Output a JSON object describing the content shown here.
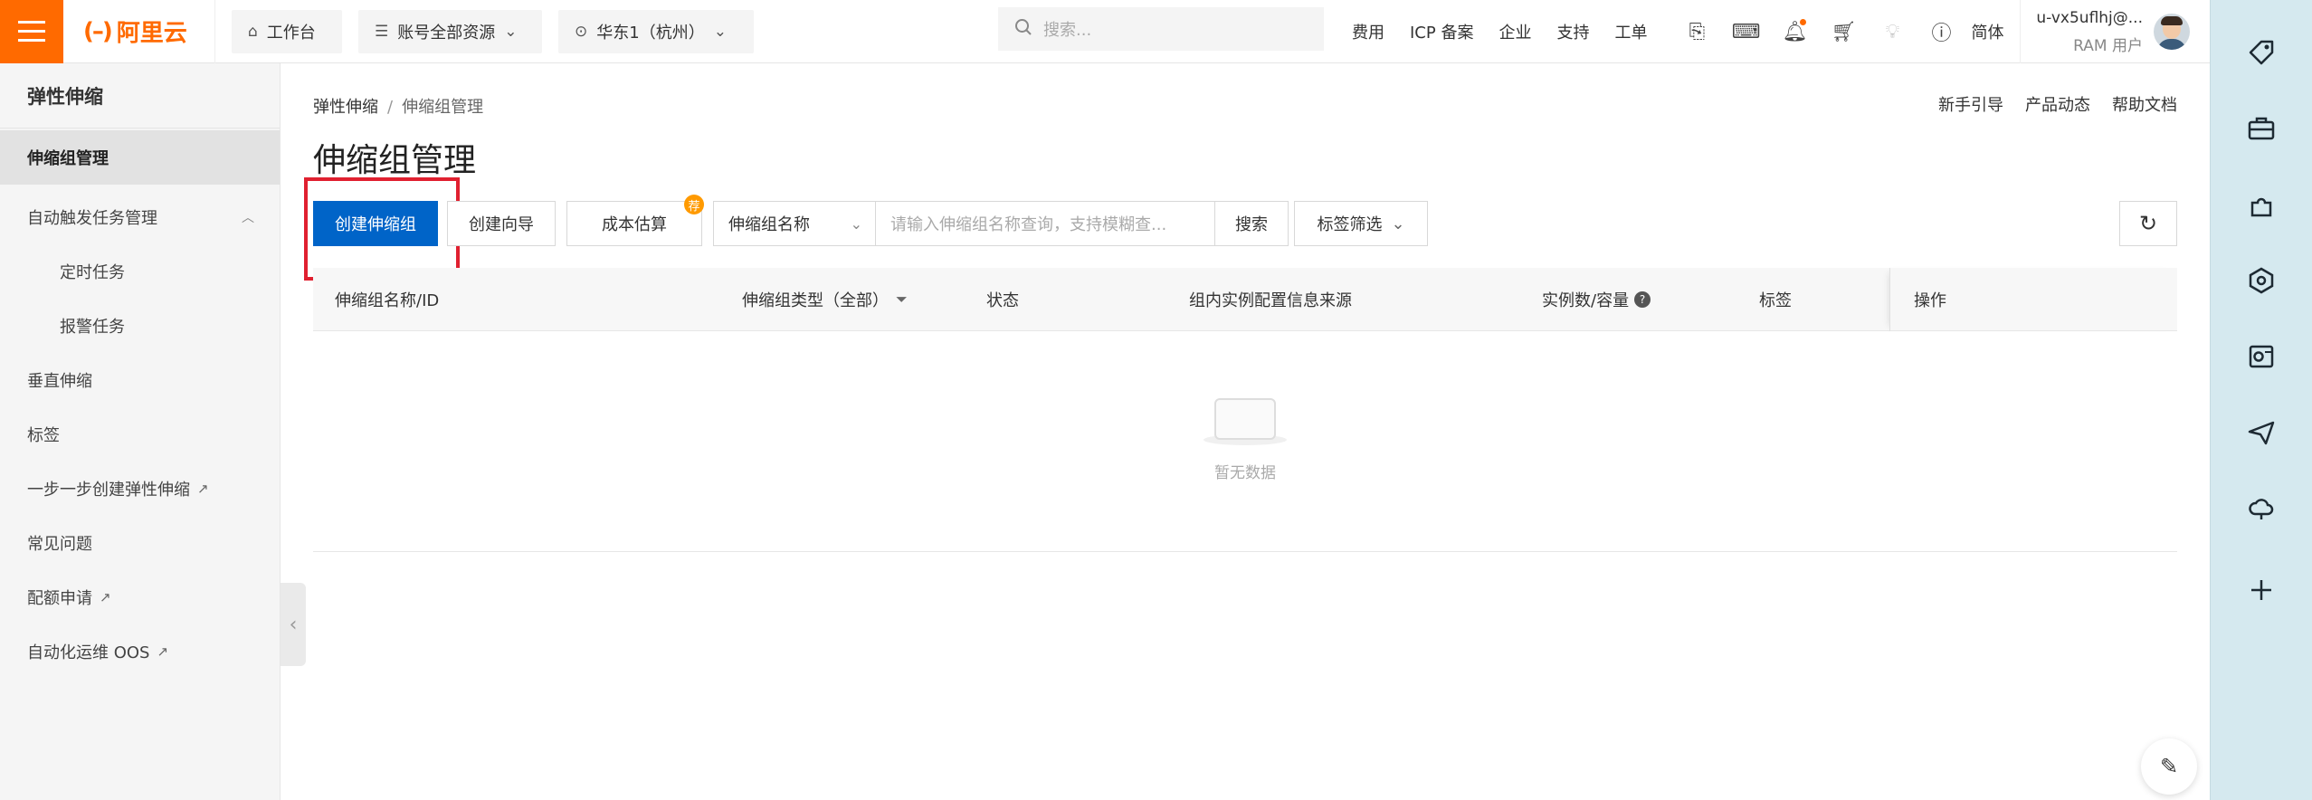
{
  "topbar": {
    "logo": "阿里云",
    "workbench": "工作台",
    "account_scope": "账号全部资源",
    "region": "华东1（杭州）",
    "search_placeholder": "搜索...",
    "links": [
      "费用",
      "ICP 备案",
      "企业",
      "支持",
      "工单"
    ],
    "lang": "简体",
    "user_name": "u-vx5uflhj@...",
    "user_role": "RAM 用户"
  },
  "sidebar": {
    "title": "弹性伸缩",
    "items": [
      {
        "label": "伸缩组管理"
      },
      {
        "label": "自动触发任务管理"
      },
      {
        "label": "定时任务"
      },
      {
        "label": "报警任务"
      },
      {
        "label": "垂直伸缩"
      },
      {
        "label": "标签"
      },
      {
        "label": "一步一步创建弹性伸缩"
      },
      {
        "label": "常见问题"
      },
      {
        "label": "配额申请"
      },
      {
        "label": "自动化运维 OOS"
      }
    ]
  },
  "breadcrumb": {
    "root": "弹性伸缩",
    "sep": "/",
    "current": "伸缩组管理"
  },
  "help_links": [
    "新手引导",
    "产品动态",
    "帮助文档"
  ],
  "page_title": "伸缩组管理",
  "toolbar": {
    "create_label": "创建伸缩组",
    "wizard_label": "创建向导",
    "cost_label": "成本估算",
    "cost_badge": "荐",
    "select_value": "伸缩组名称",
    "input_placeholder": "请输入伸缩组名称查询，支持模糊查...",
    "search_label": "搜索",
    "tag_filter_label": "标签筛选"
  },
  "table": {
    "columns": [
      "伸缩组名称/ID",
      "伸缩组类型（全部）",
      "状态",
      "组内实例配置信息来源",
      "实例数/容量",
      "标签",
      "操作"
    ],
    "empty_text": "暂无数据"
  }
}
